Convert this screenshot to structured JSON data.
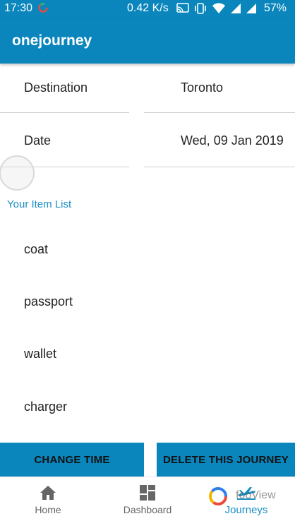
{
  "status_bar": {
    "time": "17:30",
    "net_speed": "0.42 K/s",
    "battery": "57%"
  },
  "app_bar": {
    "title": "onejourney"
  },
  "details": {
    "destination_label": "Destination",
    "destination_value": "Toronto",
    "date_label": "Date",
    "date_value": "Wed, 09 Jan 2019"
  },
  "items_section": {
    "title": "Your Item List",
    "items": [
      "coat",
      "passport",
      "wallet",
      "charger"
    ]
  },
  "actions": {
    "change_time": "CHANGE TIME",
    "delete_journey": "DELETE THIS JOURNEY"
  },
  "bottom_nav": {
    "home": "Home",
    "dashboard": "Dashboard",
    "journeys": "Journeys",
    "active": "journeys"
  },
  "watermark": {
    "text": "fooView"
  },
  "colors": {
    "primary": "#0a86bd",
    "accent_text": "#1a8fc2",
    "inactive_nav": "#666666"
  },
  "icons": [
    "notification-icon",
    "cast-icon",
    "vibrate-icon",
    "wifi-icon",
    "signal-icon",
    "home-icon",
    "dashboard-icon",
    "journeys-icon"
  ]
}
